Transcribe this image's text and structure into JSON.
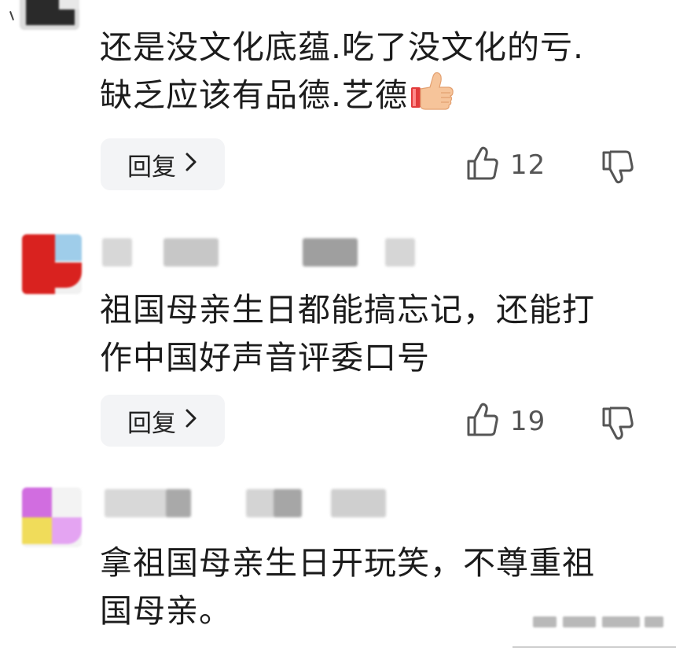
{
  "comments": [
    {
      "text_line1": "还是没文化底蕴.吃了没文化的亏.",
      "text_line2": "缺乏应该有品德.艺德",
      "reply_label": "回复",
      "likes": "12"
    },
    {
      "text_line1": "祖国母亲生日都能搞忘记，还能打",
      "text_line2": "作中国好声音评委口号",
      "reply_label": "回复",
      "likes": "19"
    },
    {
      "text_line1": "拿祖国母亲生日开玩笑，不尊重祖",
      "text_line2": "国母亲。"
    }
  ],
  "icons": {
    "like": "thumbs-up-outline-icon",
    "dislike": "thumbs-down-outline-icon",
    "reply_chevron": "chevron-right-icon",
    "emoji": "thumbs-up-emoji"
  },
  "colors": {
    "text": "#1c1c1c",
    "reply_bg": "#f3f4f6",
    "count": "#555555"
  }
}
